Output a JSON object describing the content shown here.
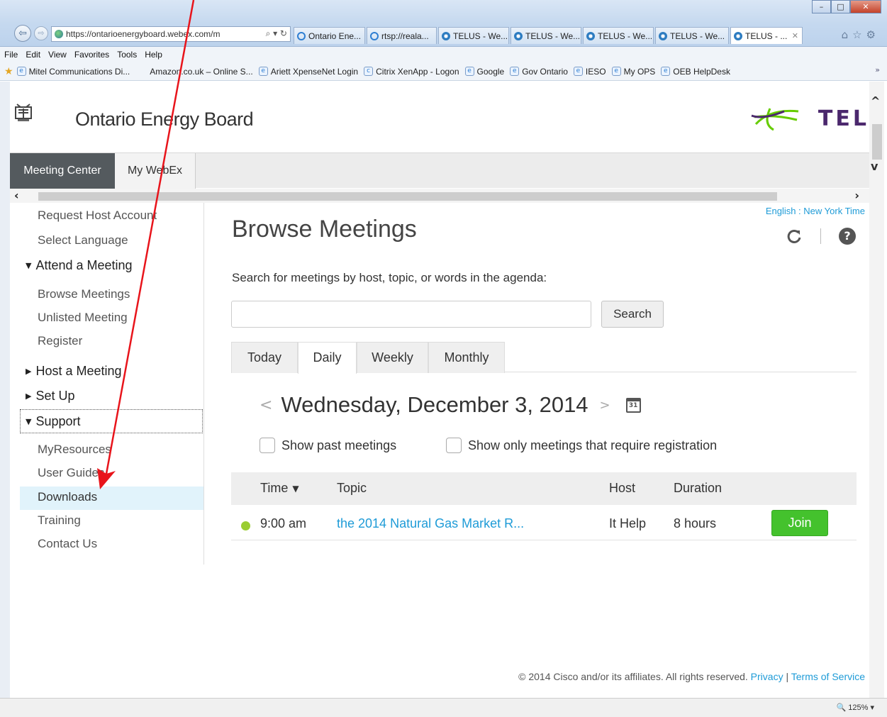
{
  "browser": {
    "url": "https://ontarioenergyboard.webex.com/m",
    "tabs": [
      {
        "label": "Ontario Ene..."
      },
      {
        "label": "rtsp://reala..."
      },
      {
        "label": "TELUS - We..."
      },
      {
        "label": "TELUS - We..."
      },
      {
        "label": "TELUS - We..."
      },
      {
        "label": "TELUS - We..."
      },
      {
        "label": "TELUS - ..."
      }
    ],
    "menu": [
      "File",
      "Edit",
      "View",
      "Favorites",
      "Tools",
      "Help"
    ],
    "favorites": [
      "Mitel Communications Di...",
      "Amazon.co.uk – Online S...",
      "Ariett XpenseNet Login",
      "Citrix XenApp - Logon",
      "Google",
      "Gov Ontario",
      "IESO",
      "My OPS",
      "OEB HelpDesk"
    ],
    "zoom": "125%"
  },
  "header": {
    "org_name": "Ontario Energy Board",
    "telus_text": "TEL"
  },
  "nav": {
    "meeting_center": "Meeting Center",
    "my_webex": "My WebEx"
  },
  "sidebar": {
    "request_host": "Request Host Account",
    "select_language": "Select Language",
    "attend": "Attend a Meeting",
    "browse": "Browse Meetings",
    "unlisted": "Unlisted Meeting",
    "register": "Register",
    "host": "Host a Meeting",
    "setup": "Set Up",
    "support": "Support",
    "myresources": "MyResources",
    "user_guides": "User Guides",
    "downloads": "Downloads",
    "training": "Training",
    "contact": "Contact Us"
  },
  "main": {
    "locale": "English : New York Time",
    "title": "Browse Meetings",
    "search_instruction": "Search for meetings by host, topic, or words in the agenda:",
    "search_value": "",
    "search_button": "Search",
    "tabs": [
      "Today",
      "Daily",
      "Weekly",
      "Monthly"
    ],
    "date": "Wednesday, December 3, 2014",
    "calendar_day": "31",
    "show_past": "Show past meetings",
    "show_registration": "Show only meetings that require registration",
    "columns": {
      "time": "Time",
      "topic": "Topic",
      "host": "Host",
      "duration": "Duration"
    },
    "meetings": [
      {
        "time": "9:00 am",
        "topic": "the 2014 Natural Gas Market R...",
        "host": "It Help",
        "duration": "8 hours",
        "action": "Join"
      }
    ]
  },
  "footer": {
    "copyright": "© 2014 Cisco and/or its affiliates. All rights reserved.",
    "privacy": "Privacy",
    "separator": "|",
    "terms": "Terms of Service"
  },
  "colors": {
    "accent_blue": "#1e9bd7",
    "join_green": "#44c22d",
    "active_nav": "#545a5e",
    "telus_purple": "#4b286d",
    "annotation_red": "#e8141b"
  }
}
